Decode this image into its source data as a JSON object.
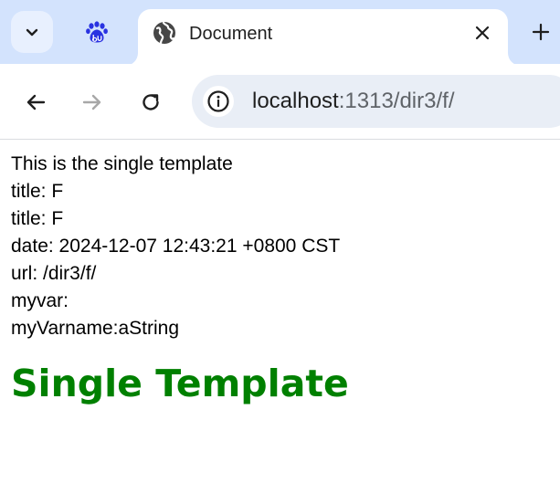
{
  "tabs": {
    "items": [
      {
        "favicon": "baidu-paw-icon",
        "title": "",
        "active": false
      },
      {
        "favicon": "globe-icon",
        "title": "Document",
        "active": true
      }
    ]
  },
  "toolbar": {
    "address": {
      "host": "localhost",
      "path": ":1313/dir3/f/"
    }
  },
  "page": {
    "lines": [
      "This is the single template",
      "title: F",
      "title: F",
      "date: 2024-12-07 12:43:21 +0800 CST",
      "url: /dir3/f/",
      "myvar:",
      "myVarname:aString"
    ],
    "heading": "Single Template"
  },
  "colors": {
    "tabstrip_bg": "#d3e3fd",
    "omnibox_bg": "#e9eef6",
    "heading": "#008000",
    "baidu_blue": "#2932e1"
  }
}
